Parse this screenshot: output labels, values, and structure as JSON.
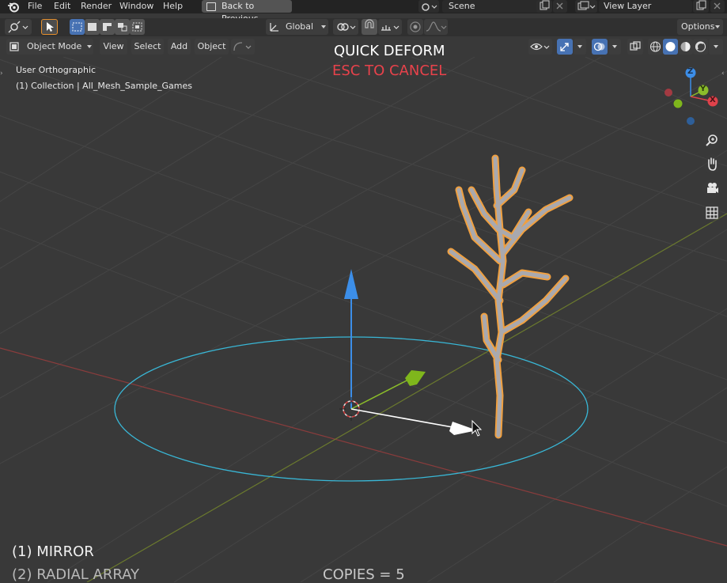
{
  "menu": {
    "items": [
      "File",
      "Edit",
      "Render",
      "Window",
      "Help"
    ],
    "back_button": "Back to Previous",
    "scene": "Scene",
    "view_layer": "View Layer"
  },
  "toolbar": {
    "transform_orientation": "Global",
    "options": "Options"
  },
  "header": {
    "mode": "Object Mode",
    "menus": [
      "View",
      "Select",
      "Add",
      "Object"
    ]
  },
  "viewport": {
    "view_name": "User Orthographic",
    "collection_info": "(1) Collection | All_Mesh_Sample_Games",
    "overlay_title": "QUICK DEFORM",
    "overlay_cancel": "ESC TO CANCEL",
    "option_1": "(1) MIRROR",
    "option_2": "(2) RADIAL ARRAY",
    "copies": "COPIES = 5"
  },
  "gizmo": {
    "axes": [
      "X",
      "Y",
      "Z"
    ]
  },
  "colors": {
    "cancel": "#e8424b",
    "x_axis": "#e0424b",
    "y_axis": "#8bbd2a",
    "z_axis": "#3c8ee8",
    "selection": "#f0a040",
    "circle": "#39b7d6"
  }
}
